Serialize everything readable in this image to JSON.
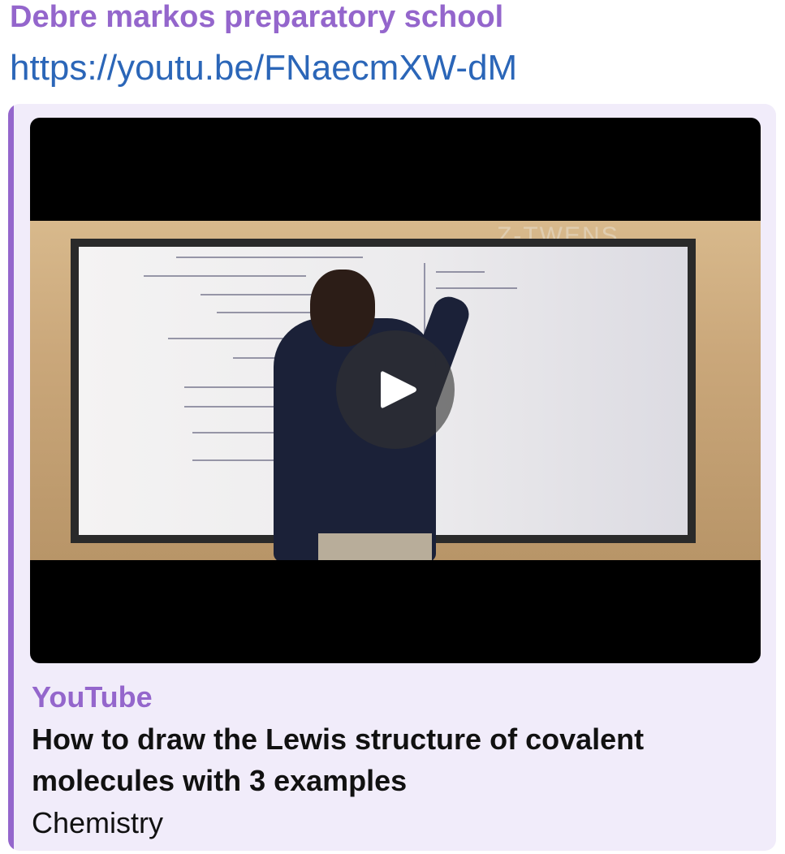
{
  "message": {
    "sender": "Debre markos preparatory school",
    "link_text": "https://youtu.be/FNaecmXW-dM"
  },
  "preview": {
    "site_name": "YouTube",
    "title": "How to draw the Lewis structure of covalent molecules with 3 examples",
    "description": "Chemistry",
    "accent_color": "#9466cc",
    "background_color": "#f1ecfa",
    "video": {
      "play_icon": "play-icon",
      "overlay_text": "Z-TWENS"
    }
  }
}
